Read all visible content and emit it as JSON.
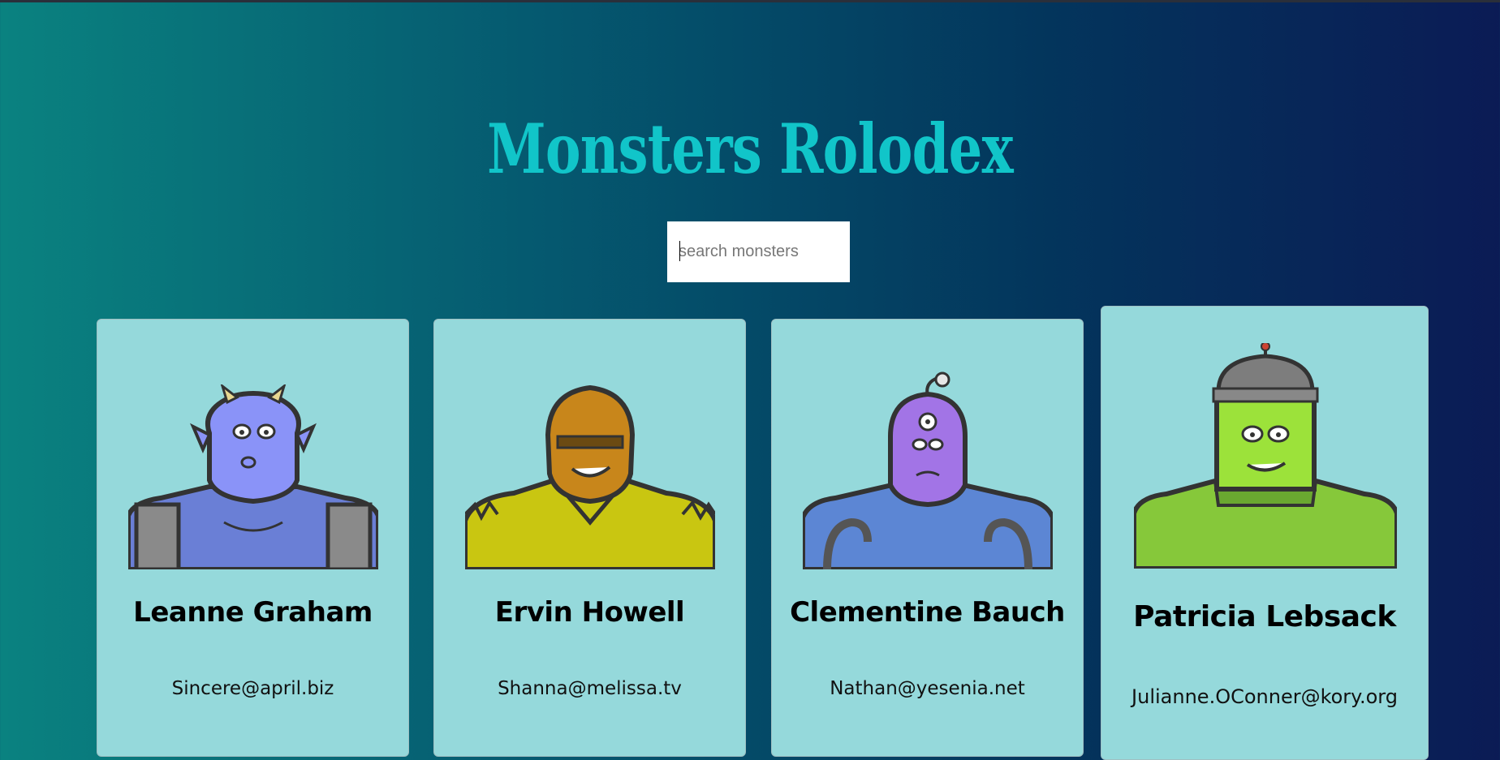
{
  "app": {
    "title": "Monsters Rolodex"
  },
  "search": {
    "placeholder": "search monsters",
    "value": ""
  },
  "monsters": [
    {
      "name": "Leanne Graham",
      "email": "Sincere@april.biz",
      "accent": "#7f8ef5"
    },
    {
      "name": "Ervin Howell",
      "email": "Shanna@melissa.tv",
      "accent": "#d4cc1a"
    },
    {
      "name": "Clementine Bauch",
      "email": "Nathan@yesenia.net",
      "accent": "#a278e6"
    },
    {
      "name": "Patricia Lebsack",
      "email": "Julianne.OConner@kory.org",
      "accent": "#86cc32"
    }
  ]
}
